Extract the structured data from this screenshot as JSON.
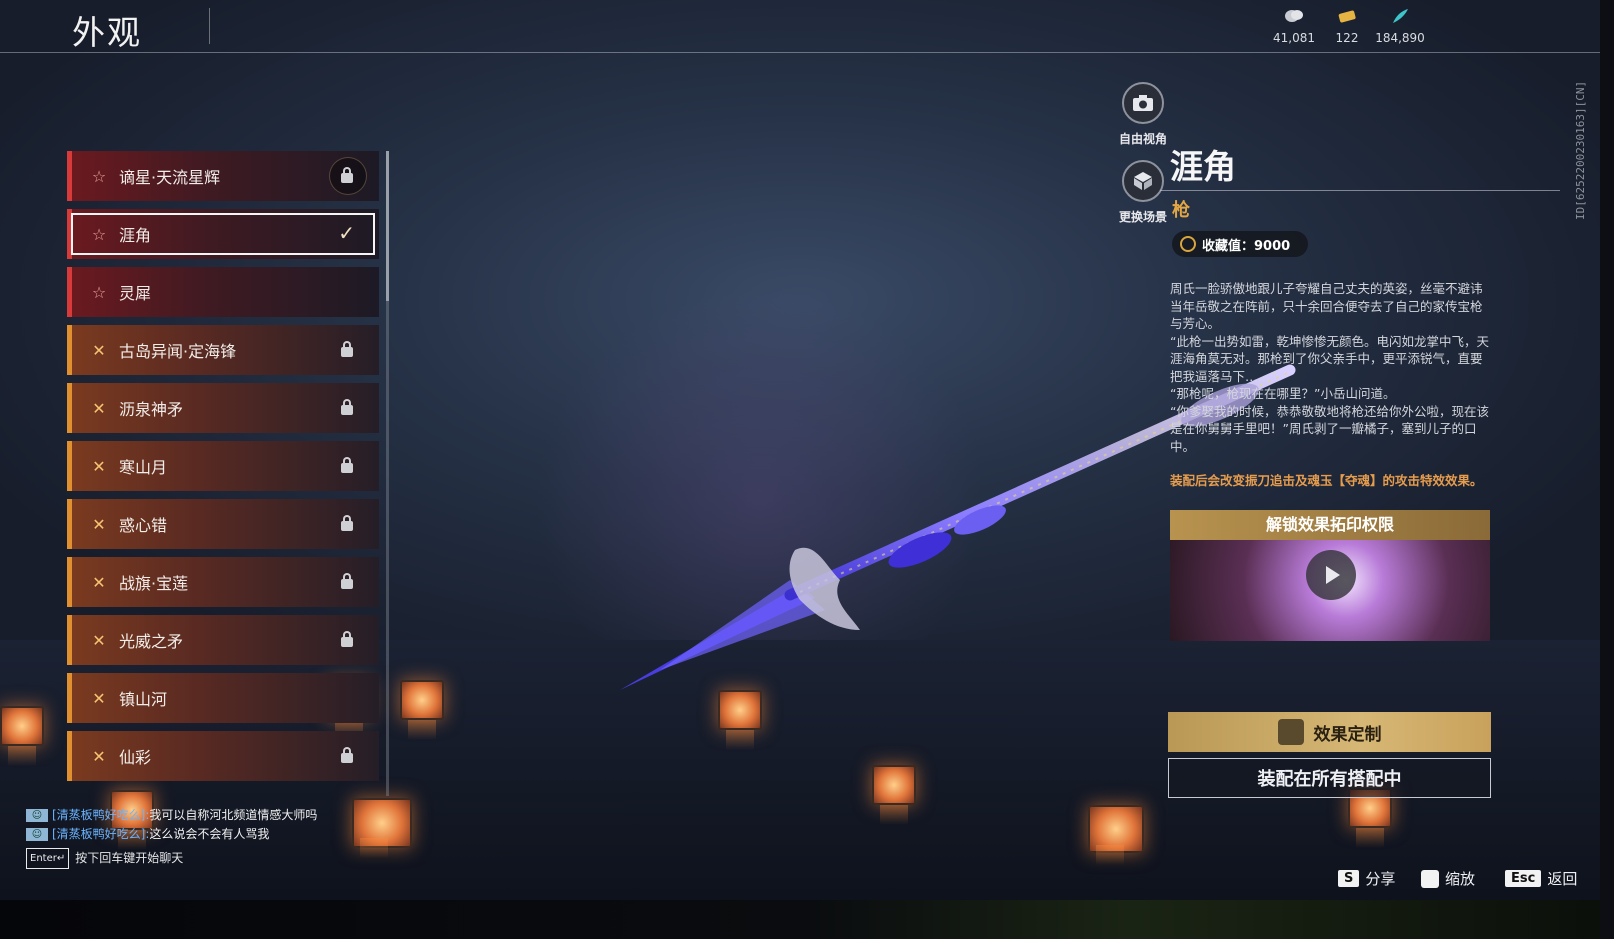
{
  "header": {
    "title": "外观",
    "currencies": [
      {
        "icon": "coin-icon",
        "value": "41,081"
      },
      {
        "icon": "ticket-icon",
        "value": "122"
      },
      {
        "icon": "feather-icon",
        "value": "184,890"
      }
    ]
  },
  "appearance_list": {
    "items": [
      {
        "label": "谪星·天流星辉",
        "rarity": "red",
        "state": "locked"
      },
      {
        "label": "涯角",
        "rarity": "red",
        "state": "equipped"
      },
      {
        "label": "灵犀",
        "rarity": "red",
        "state": "none"
      },
      {
        "label": "古岛异闻·定海锋",
        "rarity": "gold",
        "state": "locked"
      },
      {
        "label": "沥泉神矛",
        "rarity": "gold",
        "state": "locked"
      },
      {
        "label": "寒山月",
        "rarity": "gold",
        "state": "locked"
      },
      {
        "label": "惑心错",
        "rarity": "gold",
        "state": "locked"
      },
      {
        "label": "战旗·宝莲",
        "rarity": "gold",
        "state": "locked"
      },
      {
        "label": "光威之矛",
        "rarity": "gold",
        "state": "locked"
      },
      {
        "label": "镇山河",
        "rarity": "gold",
        "state": "none"
      },
      {
        "label": "仙彩",
        "rarity": "gold",
        "state": "locked"
      }
    ]
  },
  "tools": {
    "free_camera": "自由视角",
    "change_scene": "更换场景"
  },
  "detail": {
    "name": "涯角",
    "type": "枪",
    "collection": "收藏值：9000",
    "description": "周氏一脸骄傲地跟儿子夸耀自己丈夫的英姿，丝毫不避讳当年岳敬之在阵前，只十余回合便夺去了自己的家传宝枪与芳心。\n“此枪一出势如雷，乾坤惨惨无颜色。电闪如龙掌中飞，天涯海角莫无对。那枪到了你父亲手中，更平添锐气，直要把我逼落马下……”\n“那枪呢，枪现在在哪里？”小岳山问道。\n“你爹娶我的时候，恭恭敬敬地将枪还给你外公啦，现在该是在你舅舅手里吧！”周氏剥了一瓣橘子，塞到儿子的口中。",
    "effect_note": "装配后会改变振刀追击及魂玉【夺魂】的攻击特效效果。",
    "video_title": "解锁效果拓印权限",
    "customize_button": "效果定制",
    "equip_button": "装配在所有搭配中"
  },
  "side_id": "ID[6252200230163][CN]",
  "bottom_hints": {
    "share_key": "S",
    "share_label": "分享",
    "zoom_label": "缩放",
    "back_key": "Esc",
    "back_label": "返回"
  },
  "chat": {
    "messages": [
      {
        "user": "[清蒸板鸭好吃么]:",
        "text": "我可以自称河北频道情感大师吗"
      },
      {
        "user": "[清蒸板鸭好吃么]:",
        "text": "这么说会不会有人骂我"
      }
    ],
    "enter_key": "Enter↵",
    "input_hint": "按下回车键开始聊天"
  },
  "colors": {
    "red_rarity": "#d83a3a",
    "gold_rarity": "#e0902e",
    "accent_gold": "#e3a645",
    "effect_text": "#e69c4d",
    "chat_user": "#6ab4ff"
  }
}
